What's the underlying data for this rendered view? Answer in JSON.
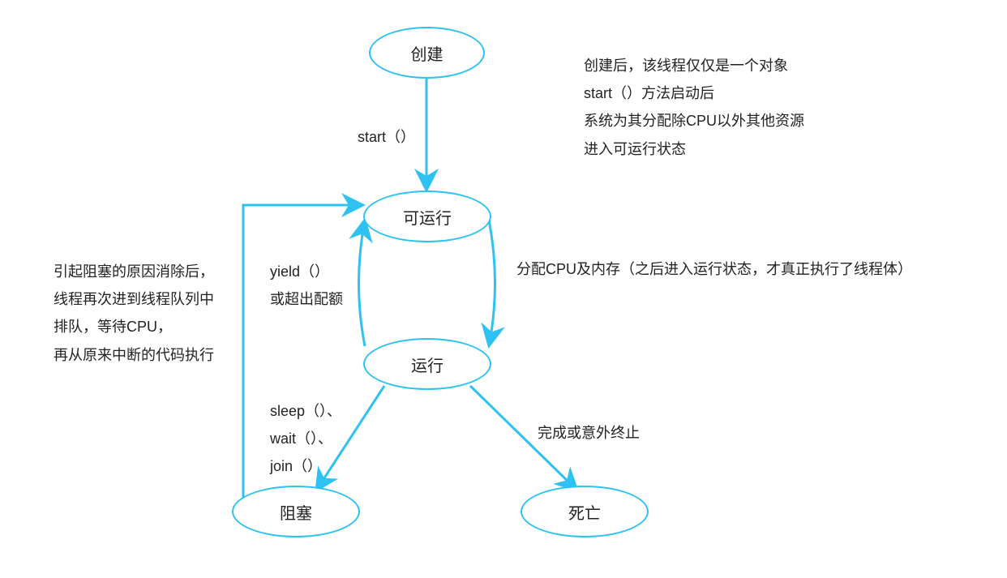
{
  "nodes": {
    "create": "创建",
    "runnable": "可运行",
    "running": "运行",
    "blocked": "阻塞",
    "dead": "死亡"
  },
  "edges": {
    "start": "start（）",
    "yield_line1": "yield（）",
    "yield_line2": "或超出配额",
    "allocate": "分配CPU及内存（之后进入运行状态，才真正执行了线程体）",
    "sleep_line1": "sleep（）、",
    "sleep_line2": "wait（）、",
    "sleep_line3": "join（）",
    "finish": "完成或意外终止"
  },
  "notes": {
    "right_top_1": "创建后，该线程仅仅是一个对象",
    "right_top_2": "start（）方法启动后",
    "right_top_3": "系统为其分配除CPU以外其他资源",
    "right_top_4": "进入可运行状态",
    "left_mid_1": "引起阻塞的原因消除后，",
    "left_mid_2": "线程再次进到线程队列中",
    "left_mid_3": "排队，等待CPU，",
    "left_mid_4": "再从原来中断的代码执行"
  },
  "colors": {
    "accent": "#2dc2f2"
  }
}
